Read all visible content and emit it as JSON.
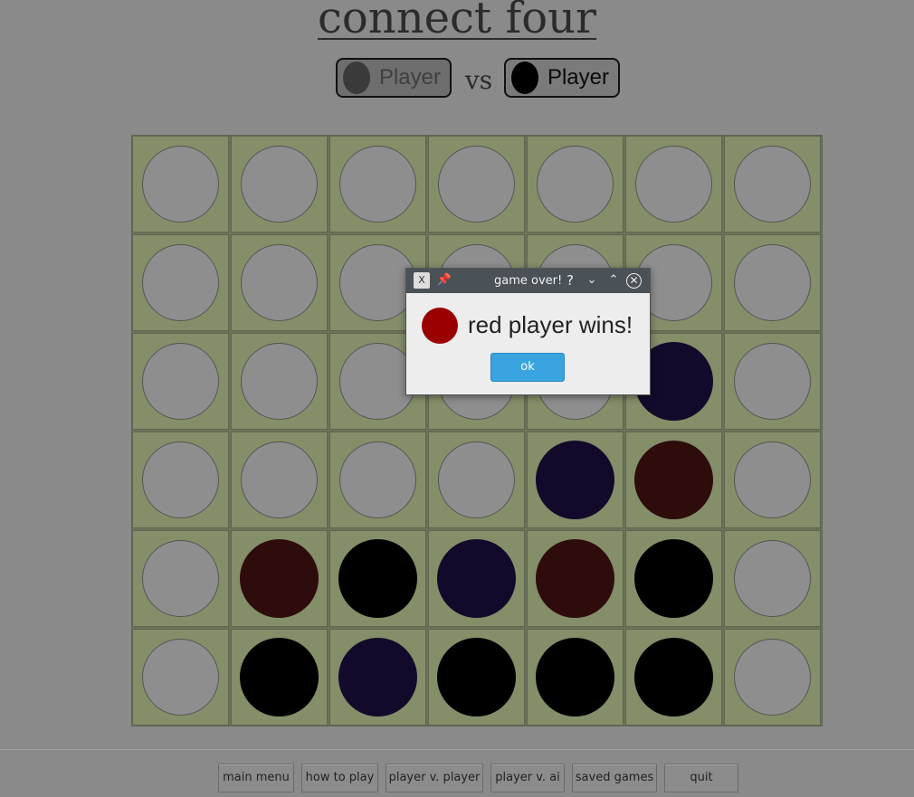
{
  "title": "connect four",
  "players": {
    "left": {
      "label": "Player",
      "chip_color": "#3a3a3a"
    },
    "vs": "vs",
    "right": {
      "label": "Player",
      "chip_color": "#000000"
    }
  },
  "board": {
    "columns": 7,
    "rows": 6,
    "grid": [
      [
        "empty",
        "empty",
        "empty",
        "empty",
        "empty",
        "empty",
        "empty"
      ],
      [
        "empty",
        "empty",
        "empty",
        "empty",
        "empty",
        "empty",
        "empty"
      ],
      [
        "empty",
        "empty",
        "empty",
        "empty",
        "empty",
        "purple",
        "empty"
      ],
      [
        "empty",
        "empty",
        "empty",
        "empty",
        "purple",
        "red",
        "empty"
      ],
      [
        "empty",
        "red",
        "black",
        "purple",
        "red",
        "black",
        "empty"
      ],
      [
        "empty",
        "black",
        "purple",
        "black",
        "black",
        "black",
        "empty"
      ]
    ],
    "colors": {
      "empty": "#8e8e8e",
      "black": "#000000",
      "purple": "#130a2b",
      "red": "#2e0c0c",
      "cell": "#848e69"
    }
  },
  "dialog": {
    "title": "game over!",
    "message": "red player wins!",
    "winner_color": "#9a0000",
    "ok_label": "ok",
    "icons": [
      "app-icon",
      "pin-icon",
      "help-icon",
      "minimize-icon",
      "maximize-icon",
      "close-icon"
    ]
  },
  "nav": {
    "main_menu": "main menu",
    "how_to_play": "how to play",
    "player_v_player": "player v. player",
    "player_v_ai": "player v. ai",
    "saved_games": "saved games",
    "quit": "quit"
  }
}
